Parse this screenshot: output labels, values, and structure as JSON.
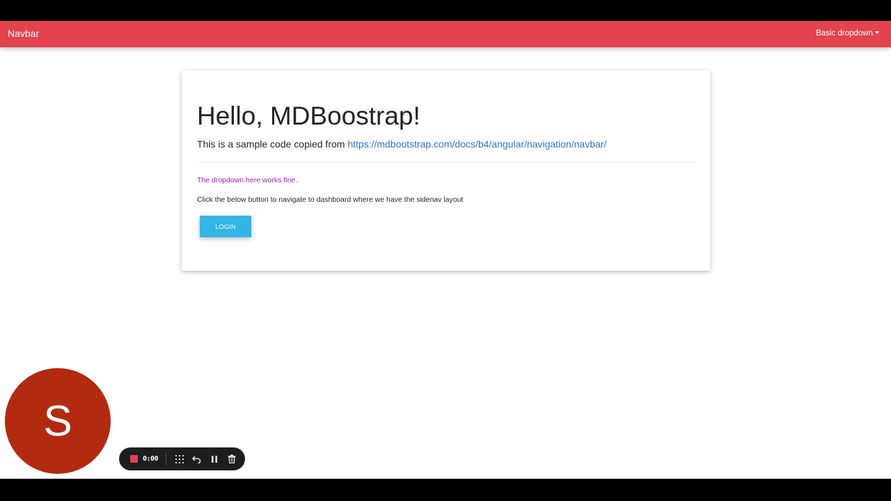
{
  "navbar": {
    "brand": "Navbar",
    "dropdown_label": "Basic dropdown",
    "color": "#e2434f"
  },
  "card": {
    "title": "Hello, MDBoostrap!",
    "lead_text": "This is a sample code copied from ",
    "lead_link": "https://mdbootstrap.com/docs/b4/angular/navigation/navbar/",
    "note": "The dropdown here works fine.",
    "instruction": "Click the below button to navigate to dashboard where we have the sidenav layout",
    "login_label": "LOGIN",
    "login_color": "#33b5e5"
  },
  "avatar": {
    "initial": "S",
    "color": "#b22b10"
  },
  "recorder": {
    "timer": "0:00",
    "icons": [
      "stop-icon",
      "grid-icon",
      "undo-icon",
      "pause-icon",
      "trash-icon"
    ]
  }
}
